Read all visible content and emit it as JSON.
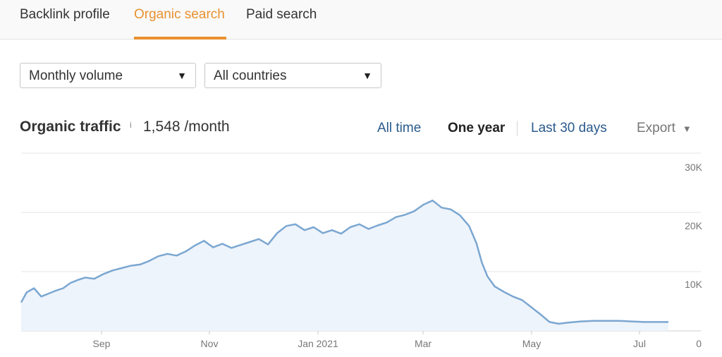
{
  "tabs": [
    {
      "label": "Backlink profile",
      "active": false
    },
    {
      "label": "Organic search",
      "active": true
    },
    {
      "label": "Paid search",
      "active": false
    }
  ],
  "filters": {
    "volume": "Monthly volume",
    "country": "All countries"
  },
  "header": {
    "title": "Organic traffic",
    "info": "i",
    "metric": "1,548 /month"
  },
  "ranges": {
    "all_time": "All time",
    "one_year": "One year",
    "last_30_days": "Last 30 days",
    "selected": "One year"
  },
  "export": {
    "label": "Export"
  },
  "colors": {
    "accent": "#e8912f",
    "line": "#7ba7d1",
    "fill": "#eef4fb",
    "link": "#2a5a8c"
  },
  "chart_data": {
    "type": "area",
    "x_tick_labels": [
      "Sep",
      "Nov",
      "Jan 2021",
      "Mar",
      "May",
      "Jul"
    ],
    "y_tick_labels": [
      "30K",
      "20K",
      "10K",
      "0"
    ],
    "ylim": [
      0,
      30000
    ],
    "grid": true,
    "series": [
      {
        "x": [
          "2020-08-01",
          "2020-08-04",
          "2020-08-08",
          "2020-08-12",
          "2020-08-16",
          "2020-08-20",
          "2020-08-24",
          "2020-08-28",
          "2020-09-01",
          "2020-09-05",
          "2020-09-10",
          "2020-09-15",
          "2020-09-20",
          "2020-09-25",
          "2020-09-30",
          "2020-10-05",
          "2020-10-10",
          "2020-10-15",
          "2020-10-20",
          "2020-10-25",
          "2020-10-30",
          "2020-11-04",
          "2020-11-09",
          "2020-11-14",
          "2020-11-19",
          "2020-11-24",
          "2020-11-29",
          "2020-12-04",
          "2020-12-09",
          "2020-12-14",
          "2020-12-19",
          "2020-12-24",
          "2020-12-29",
          "2021-01-03",
          "2021-01-08",
          "2021-01-13",
          "2021-01-18",
          "2021-01-23",
          "2021-01-28",
          "2021-02-02",
          "2021-02-07",
          "2021-02-12",
          "2021-02-17",
          "2021-02-22",
          "2021-02-27",
          "2021-03-04",
          "2021-03-09",
          "2021-03-14",
          "2021-03-19",
          "2021-03-24",
          "2021-03-29",
          "2021-04-03",
          "2021-04-07",
          "2021-04-10",
          "2021-04-13",
          "2021-04-17",
          "2021-04-22",
          "2021-04-27",
          "2021-05-02",
          "2021-05-07",
          "2021-05-12",
          "2021-05-17",
          "2021-05-22",
          "2021-05-27",
          "2021-06-03",
          "2021-06-10",
          "2021-06-17",
          "2021-06-24",
          "2021-07-01",
          "2021-07-08",
          "2021-07-15",
          "2021-07-21"
        ],
        "y": [
          4800,
          6500,
          7200,
          5800,
          6300,
          6800,
          7200,
          8100,
          8600,
          9000,
          8800,
          9600,
          10200,
          10600,
          11000,
          11200,
          11800,
          12600,
          13000,
          12700,
          13400,
          14400,
          15200,
          14100,
          14700,
          14000,
          14500,
          15000,
          15500,
          14600,
          16500,
          17700,
          18000,
          17000,
          17500,
          16500,
          17000,
          16400,
          17500,
          18000,
          17200,
          17800,
          18300,
          19200,
          19600,
          20200,
          21300,
          22000,
          20800,
          20500,
          19500,
          17700,
          14800,
          11500,
          9200,
          7500,
          6600,
          5800,
          5200,
          4000,
          2800,
          1500,
          1200,
          1400,
          1600,
          1700,
          1700,
          1700,
          1600,
          1500,
          1500,
          1500
        ]
      }
    ]
  }
}
